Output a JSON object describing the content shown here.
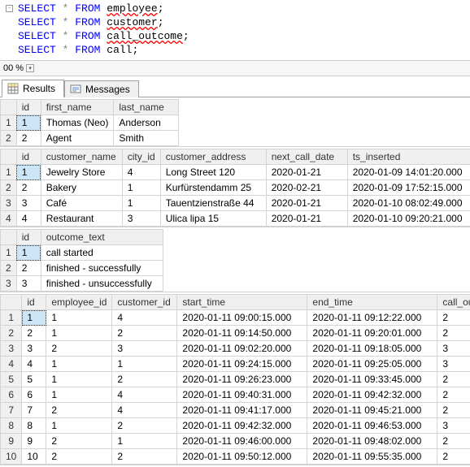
{
  "sql": {
    "lines": [
      {
        "kw1": "SELECT",
        "star": "*",
        "kw2": "FROM",
        "tbl": "employee"
      },
      {
        "kw1": "SELECT",
        "star": "*",
        "kw2": "FROM",
        "tbl": "customer"
      },
      {
        "kw1": "SELECT",
        "star": "*",
        "kw2": "FROM",
        "tbl": "call_outcome"
      },
      {
        "kw1": "SELECT",
        "star": "*",
        "kw2": "FROM",
        "tbl": "call"
      }
    ]
  },
  "zoom": {
    "value": "00 %"
  },
  "tabs": {
    "results": "Results",
    "messages": "Messages"
  },
  "grids": {
    "employee": {
      "headers": [
        "id",
        "first_name",
        "last_name"
      ],
      "rows": [
        [
          "1",
          "Thomas (Neo)",
          "Anderson"
        ],
        [
          "2",
          "Agent",
          "Smith"
        ]
      ]
    },
    "customer": {
      "headers": [
        "id",
        "customer_name",
        "city_id",
        "customer_address",
        "next_call_date",
        "ts_inserted"
      ],
      "rows": [
        [
          "1",
          "Jewelry Store",
          "4",
          "Long Street 120",
          "2020-01-21",
          "2020-01-09 14:01:20.000"
        ],
        [
          "2",
          "Bakery",
          "1",
          "Kurfürstendamm 25",
          "2020-02-21",
          "2020-01-09 17:52:15.000"
        ],
        [
          "3",
          "Café",
          "1",
          "Tauentzienstraße 44",
          "2020-01-21",
          "2020-01-10 08:02:49.000"
        ],
        [
          "4",
          "Restaurant",
          "3",
          "Ulica lipa 15",
          "2020-01-21",
          "2020-01-10 09:20:21.000"
        ]
      ]
    },
    "outcome": {
      "headers": [
        "id",
        "outcome_text"
      ],
      "rows": [
        [
          "1",
          "call started"
        ],
        [
          "2",
          "finished - successfully"
        ],
        [
          "3",
          "finished - unsuccessfully"
        ]
      ]
    },
    "call": {
      "headers": [
        "id",
        "employee_id",
        "customer_id",
        "start_time",
        "end_time",
        "call_outcome_id"
      ],
      "rows": [
        [
          "1",
          "1",
          "4",
          "2020-01-11 09:00:15.000",
          "2020-01-11 09:12:22.000",
          "2"
        ],
        [
          "2",
          "1",
          "2",
          "2020-01-11 09:14:50.000",
          "2020-01-11 09:20:01.000",
          "2"
        ],
        [
          "3",
          "2",
          "3",
          "2020-01-11 09:02:20.000",
          "2020-01-11 09:18:05.000",
          "3"
        ],
        [
          "4",
          "1",
          "1",
          "2020-01-11 09:24:15.000",
          "2020-01-11 09:25:05.000",
          "3"
        ],
        [
          "5",
          "1",
          "2",
          "2020-01-11 09:26:23.000",
          "2020-01-11 09:33:45.000",
          "2"
        ],
        [
          "6",
          "1",
          "4",
          "2020-01-11 09:40:31.000",
          "2020-01-11 09:42:32.000",
          "2"
        ],
        [
          "7",
          "2",
          "4",
          "2020-01-11 09:41:17.000",
          "2020-01-11 09:45:21.000",
          "2"
        ],
        [
          "8",
          "1",
          "2",
          "2020-01-11 09:42:32.000",
          "2020-01-11 09:46:53.000",
          "3"
        ],
        [
          "9",
          "2",
          "1",
          "2020-01-11 09:46:00.000",
          "2020-01-11 09:48:02.000",
          "2"
        ],
        [
          "10",
          "2",
          "2",
          "2020-01-11 09:50:12.000",
          "2020-01-11 09:55:35.000",
          "2"
        ]
      ]
    }
  }
}
